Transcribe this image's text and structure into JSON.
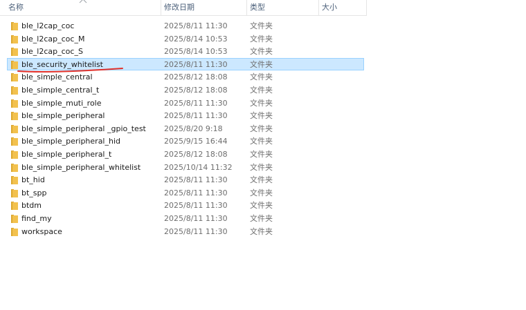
{
  "columns": {
    "name": "名称",
    "date": "修改日期",
    "type": "类型",
    "size": "大小"
  },
  "rows": [
    {
      "name": "ble_l2cap_coc",
      "date": "2025/8/11 11:30",
      "type": "文件夹"
    },
    {
      "name": "ble_l2cap_coc_M",
      "date": "2025/8/14 10:53",
      "type": "文件夹"
    },
    {
      "name": "ble_l2cap_coc_S",
      "date": "2025/8/14 10:53",
      "type": "文件夹"
    },
    {
      "name": "ble_security_whitelist",
      "date": "2025/8/11 11:30",
      "type": "文件夹",
      "selected": true
    },
    {
      "name": "ble_simple_central",
      "date": "2025/8/12 18:08",
      "type": "文件夹"
    },
    {
      "name": "ble_simple_central_t",
      "date": "2025/8/12 18:08",
      "type": "文件夹"
    },
    {
      "name": "ble_simple_muti_role",
      "date": "2025/8/11 11:30",
      "type": "文件夹"
    },
    {
      "name": "ble_simple_peripheral",
      "date": "2025/8/11 11:30",
      "type": "文件夹"
    },
    {
      "name": "ble_simple_peripheral _gpio_test",
      "date": "2025/8/20 9:18",
      "type": "文件夹"
    },
    {
      "name": "ble_simple_peripheral_hid",
      "date": "2025/9/15 16:44",
      "type": "文件夹"
    },
    {
      "name": "ble_simple_peripheral_t",
      "date": "2025/8/12 18:08",
      "type": "文件夹"
    },
    {
      "name": "ble_simple_peripheral_whitelist",
      "date": "2025/10/14 11:32",
      "type": "文件夹"
    },
    {
      "name": "bt_hid",
      "date": "2025/8/11 11:30",
      "type": "文件夹"
    },
    {
      "name": "bt_spp",
      "date": "2025/8/11 11:30",
      "type": "文件夹"
    },
    {
      "name": "btdm",
      "date": "2025/8/11 11:30",
      "type": "文件夹"
    },
    {
      "name": "find_my",
      "date": "2025/8/11 11:30",
      "type": "文件夹"
    },
    {
      "name": "workspace",
      "date": "2025/8/11 11:30",
      "type": "文件夹"
    }
  ],
  "icons": {
    "folder": "folder-icon",
    "sort": "sort-up-arrow-icon"
  },
  "colors": {
    "folder": "#f2c14e",
    "folder_dark": "#dca72f",
    "selection_bg": "#cce8ff",
    "selection_border": "#99d1ff",
    "annotation": "#e0302a",
    "header_text": "#4c607a"
  }
}
